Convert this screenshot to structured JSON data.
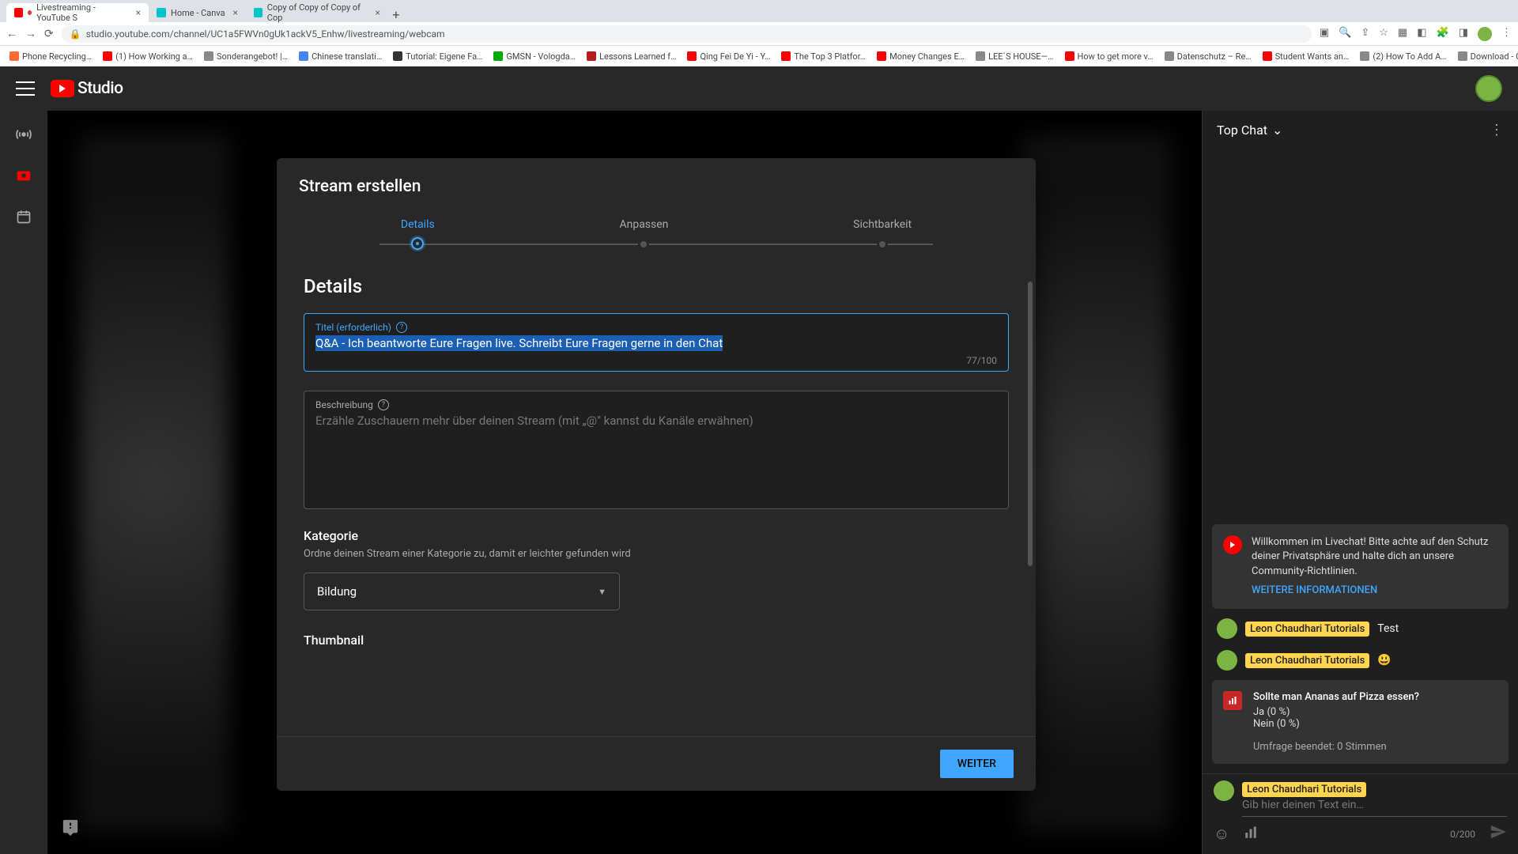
{
  "browser": {
    "tabs": [
      {
        "title": "Livestreaming - YouTube S",
        "favicon": "#f00",
        "active": true,
        "recording": true
      },
      {
        "title": "Home - Canva",
        "favicon": "#00c4cc"
      },
      {
        "title": "Copy of Copy of Copy of Cop",
        "favicon": "#00c4cc"
      }
    ],
    "url": "studio.youtube.com/channel/UC1a5FWVn0gUk1ackV5_Enhw/livestreaming/webcam",
    "bookmarks": [
      {
        "label": "Phone Recycling…",
        "color": "#ff6b35"
      },
      {
        "label": "(1) How Working a…",
        "color": "#f00"
      },
      {
        "label": "Sonderangebot! |…",
        "color": "#888"
      },
      {
        "label": "Chinese translati…",
        "color": "#4285f4"
      },
      {
        "label": "Tutorial: Eigene Fa…",
        "color": "#333"
      },
      {
        "label": "GMSN - Vologda…",
        "color": "#0a0"
      },
      {
        "label": "Lessons Learned f…",
        "color": "#b71c1c"
      },
      {
        "label": "Qing Fei De Yi - Y…",
        "color": "#f00"
      },
      {
        "label": "The Top 3 Platfor…",
        "color": "#f00"
      },
      {
        "label": "Money Changes E…",
        "color": "#f00"
      },
      {
        "label": "LEE´S HOUSE—…",
        "color": "#888"
      },
      {
        "label": "How to get more v…",
        "color": "#f00"
      },
      {
        "label": "Datenschutz – Re…",
        "color": "#888"
      },
      {
        "label": "Student Wants an…",
        "color": "#f00"
      },
      {
        "label": "(2) How To Add A…",
        "color": "#888"
      },
      {
        "label": "Download - Cooki…",
        "color": "#888"
      }
    ]
  },
  "header": {
    "studio_label": "Studio"
  },
  "modal": {
    "title": "Stream erstellen",
    "steps": [
      "Details",
      "Anpassen",
      "Sichtbarkeit"
    ],
    "section_heading": "Details",
    "title_field": {
      "label": "Titel (erforderlich)",
      "value": "Q&A - Ich beantworte Eure Fragen live. Schreibt Eure Fragen gerne in den Chat",
      "counter": "77/100"
    },
    "desc_field": {
      "label": "Beschreibung",
      "placeholder": "Erzähle Zuschauern mehr über deinen Stream (mit „@\" kannst du Kanäle erwähnen)"
    },
    "category": {
      "heading": "Kategorie",
      "hint": "Ordne deinen Stream einer Kategorie zu, damit er leichter gefunden wird",
      "value": "Bildung"
    },
    "thumbnail_heading": "Thumbnail",
    "next_button": "WEITER"
  },
  "chat": {
    "header": "Top Chat",
    "welcome": {
      "text": "Willkommen im Livechat! Bitte achte auf den Schutz deiner Privatsphäre und halte dich an unsere Community-Richtlinien.",
      "link": "WEITERE INFORMATIONEN"
    },
    "author": "Leon Chaudhari Tutorials",
    "msg1": "Test",
    "msg2_emoji": "😃",
    "poll": {
      "question": "Sollte man Ananas auf Pizza essen?",
      "opt1": "Ja (0 %)",
      "opt2": "Nein (0 %)",
      "ended": "Umfrage beendet: 0 Stimmen"
    },
    "input_placeholder": "Gib hier deinen Text ein…",
    "counter": "0/200"
  }
}
